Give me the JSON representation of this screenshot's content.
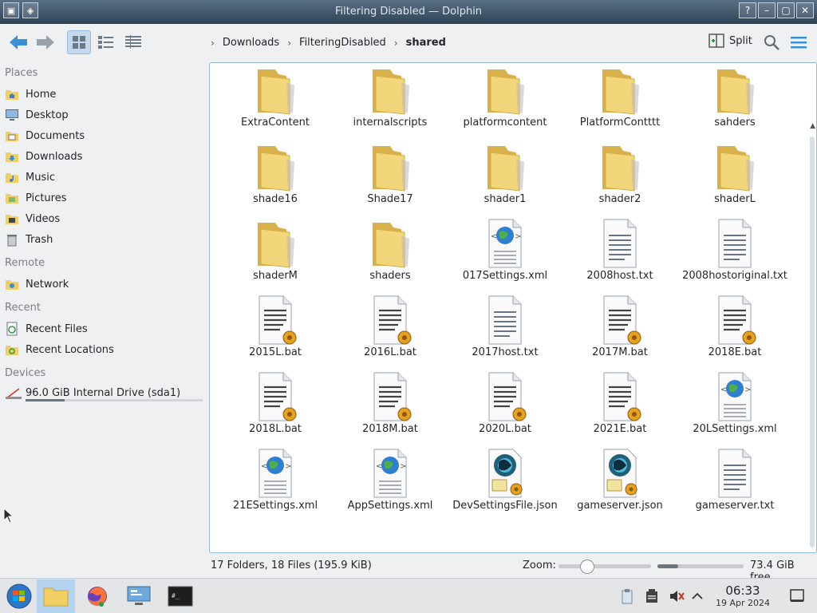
{
  "window": {
    "title": "Filtering Disabled — Dolphin",
    "title_overlay": "Mozilla Firefox",
    "close_glyph": "✕",
    "max_glyph": "▢",
    "min_glyph": "–",
    "help_glyph": "?"
  },
  "toolbar": {
    "breadcrumb": [
      "Downloads",
      "FilteringDisabled",
      "shared"
    ],
    "split_label": "Split"
  },
  "sidebar": {
    "sections": [
      {
        "title": "Places",
        "items": [
          {
            "label": "Home",
            "icon": "home-folder-icon"
          },
          {
            "label": "Desktop",
            "icon": "desktop-icon"
          },
          {
            "label": "Documents",
            "icon": "documents-folder-icon"
          },
          {
            "label": "Downloads",
            "icon": "downloads-folder-icon"
          },
          {
            "label": "Music",
            "icon": "music-folder-icon"
          },
          {
            "label": "Pictures",
            "icon": "pictures-folder-icon"
          },
          {
            "label": "Videos",
            "icon": "videos-folder-icon"
          },
          {
            "label": "Trash",
            "icon": "trash-icon"
          }
        ]
      },
      {
        "title": "Remote",
        "items": [
          {
            "label": "Network",
            "icon": "network-icon"
          }
        ]
      },
      {
        "title": "Recent",
        "items": [
          {
            "label": "Recent Files",
            "icon": "recent-files-icon"
          },
          {
            "label": "Recent Locations",
            "icon": "recent-locations-icon"
          }
        ]
      },
      {
        "title": "Devices",
        "items": [
          {
            "label": "96.0 GiB Internal Drive (sda1)",
            "icon": "drive-icon",
            "used_fraction": 0.22
          }
        ]
      }
    ]
  },
  "files": [
    {
      "name": "ExtraContent",
      "type": "folder"
    },
    {
      "name": "internalscripts",
      "type": "folder"
    },
    {
      "name": "platformcontent",
      "type": "folder"
    },
    {
      "name": "PlatformContttt",
      "type": "folder"
    },
    {
      "name": "sahders",
      "type": "folder"
    },
    {
      "name": "shade16",
      "type": "folder"
    },
    {
      "name": "Shade17",
      "type": "folder"
    },
    {
      "name": "shader1",
      "type": "folder"
    },
    {
      "name": "shader2",
      "type": "folder"
    },
    {
      "name": "shaderL",
      "type": "folder"
    },
    {
      "name": "shaderM",
      "type": "folder"
    },
    {
      "name": "shaders",
      "type": "folder"
    },
    {
      "name": "017Settings.xml",
      "type": "xml"
    },
    {
      "name": "2008host.txt",
      "type": "txt"
    },
    {
      "name": "2008hostoriginal.txt",
      "type": "txt"
    },
    {
      "name": "2015L.bat",
      "type": "bat"
    },
    {
      "name": "2016L.bat",
      "type": "bat"
    },
    {
      "name": "2017host.txt",
      "type": "txt"
    },
    {
      "name": "2017M.bat",
      "type": "bat"
    },
    {
      "name": "2018E.bat",
      "type": "bat"
    },
    {
      "name": "2018L.bat",
      "type": "bat"
    },
    {
      "name": "2018M.bat",
      "type": "bat"
    },
    {
      "name": "2020L.bat",
      "type": "bat"
    },
    {
      "name": "2021E.bat",
      "type": "bat"
    },
    {
      "name": "20LSettings.xml",
      "type": "xml"
    },
    {
      "name": "21ESettings.xml",
      "type": "xml"
    },
    {
      "name": "AppSettings.xml",
      "type": "xml"
    },
    {
      "name": "DevSettingsFile.json",
      "type": "json"
    },
    {
      "name": "gameserver.json",
      "type": "json"
    },
    {
      "name": "gameserver.txt",
      "type": "txt"
    }
  ],
  "status": {
    "summary": "17 Folders, 18 Files (195.9 KiB)",
    "zoom_label": "Zoom:",
    "zoom_fraction": 0.28,
    "free_space": "73.4 GiB free",
    "used_fraction": 0.24
  },
  "taskbar": {
    "time": "06:33",
    "date": "19 Apr 2024"
  },
  "colors": {
    "accent": "#3daee9",
    "folder": "#f3d57a",
    "selection": "#b4d3f0"
  }
}
